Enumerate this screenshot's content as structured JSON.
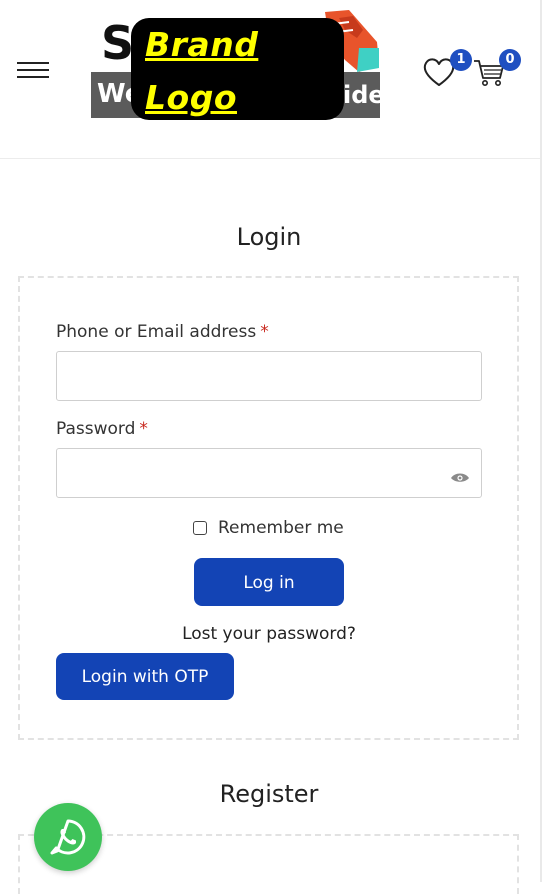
{
  "header": {
    "menu_icon": "hamburger-menu-icon",
    "logo": {
      "brand_text": "Brand \nLogo",
      "partial_left_top": "S",
      "partial_left_bottom": "We",
      "partial_right_bottom": "ide"
    },
    "wishlist": {
      "icon": "heart-icon",
      "count": "1"
    },
    "cart": {
      "icon": "cart-icon",
      "count": "0"
    },
    "badge_color": "#1f4fc1"
  },
  "login": {
    "title": "Login",
    "username_label": "Phone or Email address",
    "username_required": "*",
    "username_value": "",
    "password_label": "Password",
    "password_required": "*",
    "password_value": "",
    "password_toggle_icon": "eye-icon",
    "remember_label": "Remember me",
    "login_button": "Log in",
    "lost_password": "Lost your password?",
    "otp_button": "Login with OTP"
  },
  "register": {
    "title": "Register"
  },
  "floating": {
    "whatsapp_icon": "whatsapp-icon",
    "whatsapp_color": "#3fc35a"
  },
  "colors": {
    "primary_button": "#1344b5",
    "required_marker": "#c8281e"
  }
}
